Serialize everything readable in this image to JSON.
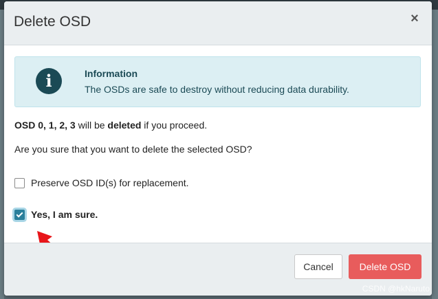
{
  "modal": {
    "title": "Delete OSD",
    "close_glyph": "×"
  },
  "alert": {
    "icon": "info-icon",
    "title": "Information",
    "text": "The OSDs are safe to destroy without reducing data durability."
  },
  "body": {
    "line1_osd_prefix": "OSD 0, 1, 2, 3",
    "line1_mid": " will be ",
    "line1_deleted": "deleted",
    "line1_suffix": " if you proceed.",
    "line2": "Are you sure that you want to delete the selected OSD?"
  },
  "checkboxes": {
    "preserve": {
      "label": "Preserve OSD ID(s) for replacement.",
      "checked": false
    },
    "sure": {
      "label": "Yes, I am sure.",
      "checked": true
    }
  },
  "footer": {
    "cancel_label": "Cancel",
    "delete_label": "Delete OSD"
  },
  "watermark": "CSDN @hkNaruto",
  "colors": {
    "primary_button": "#e85c5c",
    "info_text": "#1b4a55",
    "checkbox_checked": "#2a7f9b",
    "annotation_arrow": "#e8161a"
  }
}
